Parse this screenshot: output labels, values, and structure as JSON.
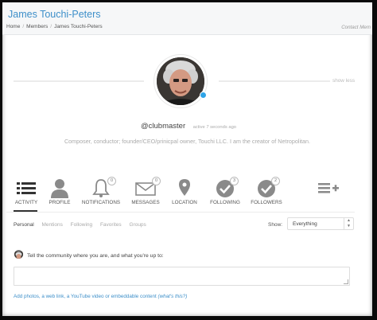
{
  "page": {
    "title": "James Touchi-Peters",
    "breadcrumb": [
      "Home",
      "Members",
      "James Touchi-Peters"
    ],
    "contact_link": "Contact Mem"
  },
  "profile": {
    "show_less": "show less",
    "handle": "@clubmaster",
    "active": "active 7 seconds ago",
    "bio": "Composer, conductor; founder/CEO/prinicpal owner, Touchi LLC. I am the creator of Netropolitan.",
    "status_color": "#2fa4e7"
  },
  "nav": {
    "items": [
      {
        "label": "ACTIVITY",
        "icon": "activity-list-icon"
      },
      {
        "label": "PROFILE",
        "icon": "person-icon"
      },
      {
        "label": "NOTIFICATIONS",
        "icon": "bell-icon",
        "badge": "0"
      },
      {
        "label": "MESSAGES",
        "icon": "envelope-icon",
        "badge": "0"
      },
      {
        "label": "LOCATION",
        "icon": "map-pin-icon"
      },
      {
        "label": "FOLLOWING",
        "icon": "check-circle-icon",
        "badge": "3"
      },
      {
        "label": "FOLLOWERS",
        "icon": "check-circle-icon",
        "badge": "2"
      }
    ],
    "more_icon": "list-plus-icon"
  },
  "subnav": {
    "tabs": [
      "Personal",
      "Mentions",
      "Following",
      "Favorites",
      "Groups"
    ],
    "show_label": "Show:",
    "filter_value": "Everything"
  },
  "post": {
    "prompt": "Tell the community where you are, and what you're up to:",
    "add_text": "Add photos, a web link, a YouTube video or embeddable content",
    "help": "(what's this?)"
  },
  "colors": {
    "accent": "#3d8fc9",
    "icon": "#8a8a8a"
  }
}
